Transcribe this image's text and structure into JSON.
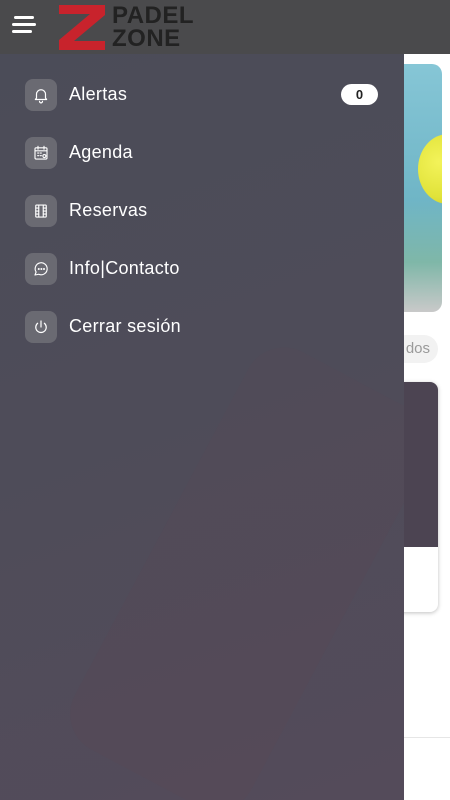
{
  "app": {
    "logo_top": "PADEL",
    "logo_bottom": "ZONE",
    "logo_letter": "Z",
    "colors": {
      "brand_red": "#c8232c",
      "topbar": "#4a4a4c",
      "drawer": "#4e4c59"
    }
  },
  "menu": {
    "items": [
      {
        "label": "Alertas",
        "icon": "bell-icon",
        "badge": "0"
      },
      {
        "label": "Agenda",
        "icon": "calendar-icon"
      },
      {
        "label": "Reservas",
        "icon": "film-icon"
      },
      {
        "label": "Info|Contacto",
        "icon": "chat-icon"
      },
      {
        "label": "Cerrar sesión",
        "icon": "power-icon"
      }
    ]
  },
  "background": {
    "chip_text": "dos"
  }
}
